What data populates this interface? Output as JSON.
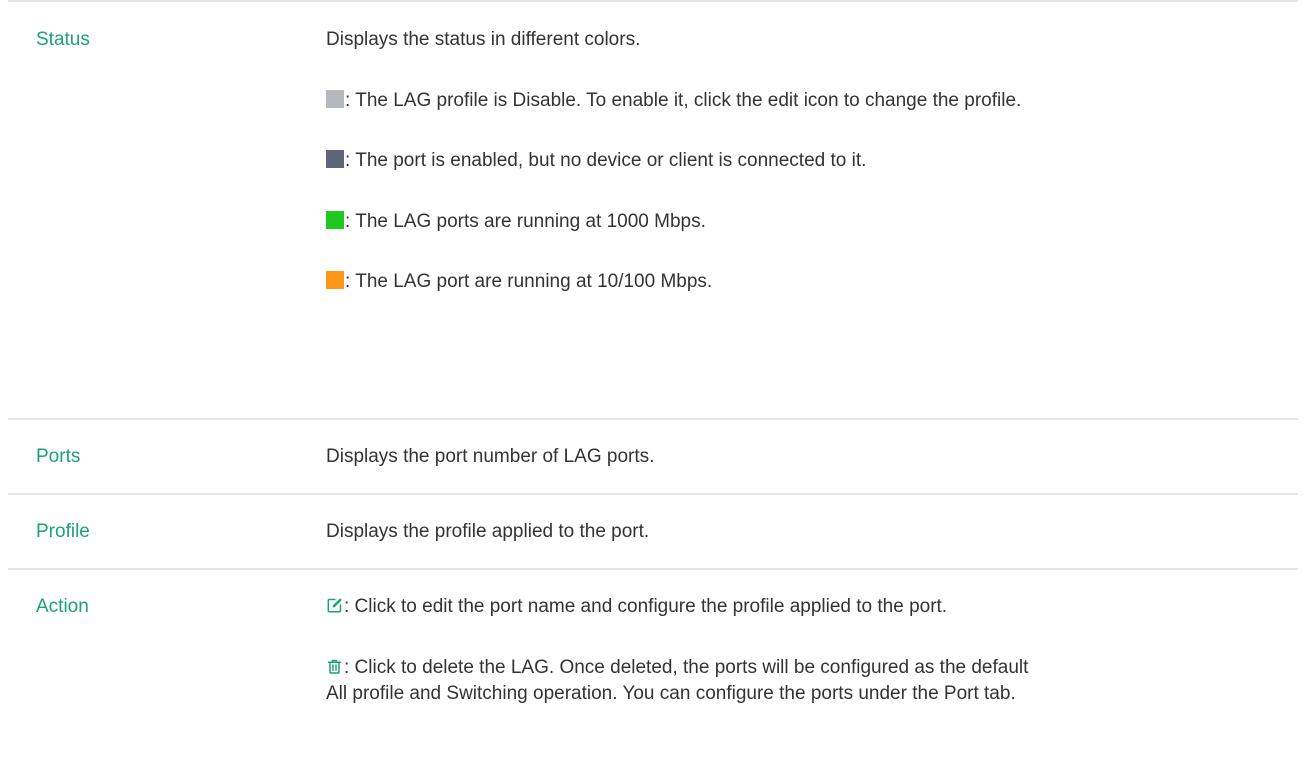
{
  "colors": {
    "label": "#1aa27a",
    "border": "#e2e7ec",
    "text": "#333333",
    "disabled": "#b5b8bc",
    "linkdown": "#5d6678",
    "speed_1000": "#1ec81e",
    "speed_100": "#fb9616"
  },
  "rows": {
    "status": {
      "label": "Status",
      "intro": "Displays the status in different colors.",
      "items": [
        {
          "swatch": "disabled",
          "text": ": The LAG profile is Disable. To enable it, click the edit icon to change the profile."
        },
        {
          "swatch": "linkdown",
          "text": ": The port is enabled, but no device or client is connected to it."
        },
        {
          "swatch": "speed_1000",
          "text": ": The LAG ports are running at 1000 Mbps."
        },
        {
          "swatch": "speed_100",
          "text": ": The LAG port are running at 10/100 Mbps."
        }
      ]
    },
    "ports": {
      "label": "Ports",
      "desc": "Displays the port number of LAG ports."
    },
    "profile": {
      "label": "Profile",
      "desc": "Displays the profile applied to the port."
    },
    "action": {
      "label": "Action",
      "edit_icon": "edit-icon",
      "edit_text": ": Click to edit the port name and configure the profile applied to the port.",
      "delete_icon": "trash-icon",
      "delete_text_line1": ": Click to delete the LAG. Once deleted, the ports will be configured as the default",
      "delete_text_line2": "All profile and Switching operation. You can configure the ports under the Port tab."
    }
  }
}
